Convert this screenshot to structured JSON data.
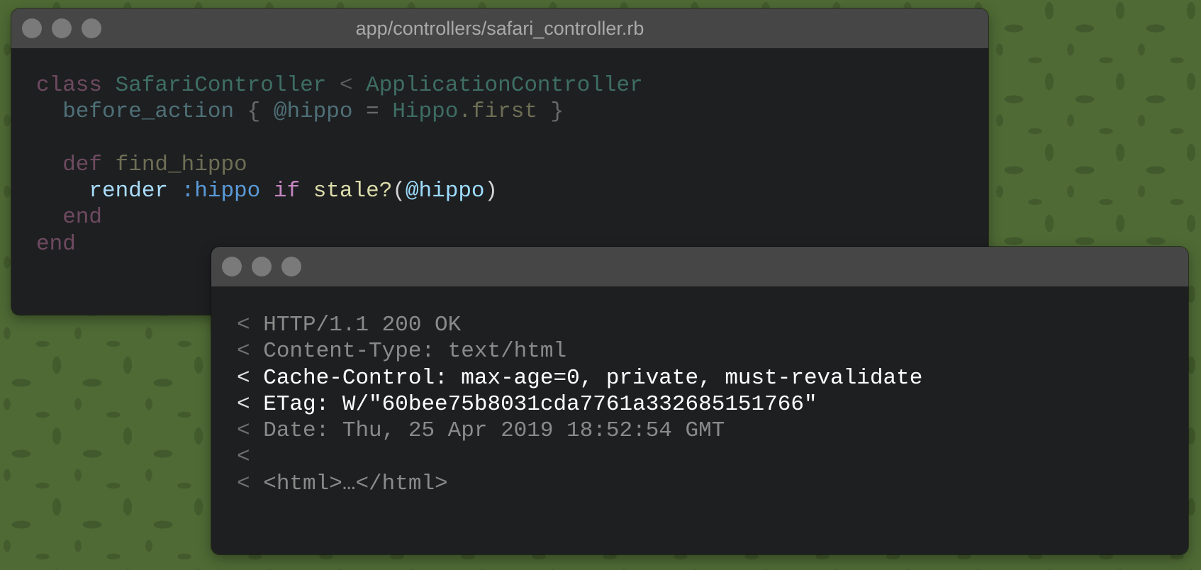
{
  "code_window": {
    "title": "app/controllers/safari_controller.rb",
    "lines": [
      [
        {
          "t": "class ",
          "c": "#6e4a60"
        },
        {
          "t": "SafariController",
          "c": "#3e6e63"
        },
        {
          "t": " < ",
          "c": "#5a5a5a"
        },
        {
          "t": "ApplicationController",
          "c": "#3e6e63"
        }
      ],
      [
        {
          "t": "  before_action ",
          "c": "#4f7078"
        },
        {
          "t": "{ ",
          "c": "#6a6a6a"
        },
        {
          "t": "@hippo",
          "c": "#4f7078"
        },
        {
          "t": " = ",
          "c": "#6a6a6a"
        },
        {
          "t": "Hippo",
          "c": "#3e6e63"
        },
        {
          "t": ".first",
          "c": "#6e6e55"
        },
        {
          "t": " }",
          "c": "#6a6a6a"
        }
      ],
      [],
      [
        {
          "t": "  def ",
          "c": "#6e4a60"
        },
        {
          "t": "find_hippo",
          "c": "#6e6e55"
        }
      ],
      [
        {
          "t": "    render ",
          "c": "#a9dcfb"
        },
        {
          "t": ":hippo",
          "c": "#5a9ad8"
        },
        {
          "t": " if ",
          "c": "#c586c0"
        },
        {
          "t": "stale?",
          "c": "#dcdcaa"
        },
        {
          "t": "(",
          "c": "#d4d4d4"
        },
        {
          "t": "@hippo",
          "c": "#9cdcfe"
        },
        {
          "t": ")",
          "c": "#d4d4d4"
        }
      ],
      [
        {
          "t": "  end",
          "c": "#6e4a60"
        }
      ],
      [
        {
          "t": "end",
          "c": "#6e4a60"
        }
      ]
    ]
  },
  "http_window": {
    "lines": [
      {
        "prefix": "< ",
        "text": "HTTP/1.1 200 OK",
        "highlight": false
      },
      {
        "prefix": "< ",
        "text": "Content-Type: text/html",
        "highlight": false
      },
      {
        "prefix": "< ",
        "text": "Cache-Control: max-age=0, private, must-revalidate",
        "highlight": true
      },
      {
        "prefix": "< ",
        "text": "ETag: W/\"60bee75b8031cda7761a332685151766\"",
        "highlight": true
      },
      {
        "prefix": "< ",
        "text": "Date: Thu, 25 Apr 2019 18:52:54 GMT",
        "highlight": false
      },
      {
        "prefix": "<",
        "text": "",
        "highlight": false
      },
      {
        "prefix": "< ",
        "text": "<html>…</html>",
        "highlight": false
      }
    ]
  }
}
